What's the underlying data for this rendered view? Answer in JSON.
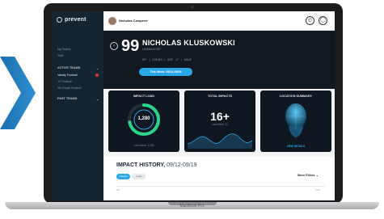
{
  "app": {
    "brand": "prevent"
  },
  "sidebar": {
    "items": [
      {
        "label": "My Teams"
      },
      {
        "label": "Staff"
      },
      {
        "label": "ACTIVE TEAMS"
      },
      {
        "label": "Varsity Football"
      },
      {
        "label": "JV Football"
      },
      {
        "label": "9th Grade Football"
      },
      {
        "label": "PAST TEAMS"
      }
    ]
  },
  "header": {
    "user": "Nicholas Cowpers"
  },
  "player": {
    "number": "99",
    "name": "NICHOLAS KLUSKOWSKI",
    "position": "LINEBACKER",
    "meta": "6'0\"  |  215LBS  |  AGE 17  |  MALE"
  },
  "week_selector": "This Week: 09/12-09/19",
  "cards": {
    "impact_load": {
      "title": "IMPACT LOAD",
      "value": "1,280",
      "footer": "Last Week: 1,100",
      "level": 0.72
    },
    "total_impacts": {
      "title": "TOTAL IMPACTS",
      "value": "16+",
      "sub": "Last Week: 12"
    },
    "location_summary": {
      "title": "LOCATION SUMMARY",
      "link": "VIEW DETAILS"
    }
  },
  "history": {
    "title": "IMPACT HISTORY,",
    "range": "09/12-09/19",
    "tabs": [
      "Impacts",
      "Load"
    ],
    "filters": "More Filters",
    "axis_left": "150",
    "axis_right": "1000"
  },
  "device": {
    "label": "MacBook Pro"
  },
  "colors": {
    "accent": "#2aa7e6",
    "sidebar": "#152433",
    "hero": "#111920",
    "card": "#0f1720"
  }
}
